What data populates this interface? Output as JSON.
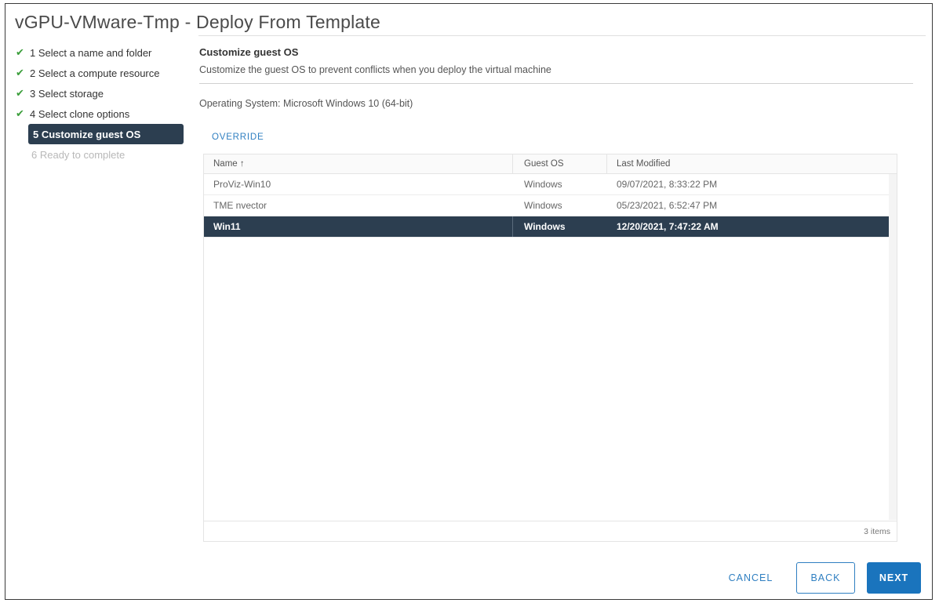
{
  "window": {
    "title": "vGPU-VMware-Tmp - Deploy From Template"
  },
  "steps": [
    {
      "label": "1 Select a name and folder",
      "state": "done"
    },
    {
      "label": "2 Select a compute resource",
      "state": "done"
    },
    {
      "label": "3 Select storage",
      "state": "done"
    },
    {
      "label": "4 Select clone options",
      "state": "done"
    },
    {
      "label": "5 Customize guest OS",
      "state": "active"
    },
    {
      "label": "6 Ready to complete",
      "state": "disabled"
    }
  ],
  "main": {
    "title": "Customize guest OS",
    "description": "Customize the guest OS to prevent conflicts when you deploy the virtual machine",
    "os_line": "Operating System: Microsoft Windows 10 (64-bit)",
    "override_label": "OVERRIDE"
  },
  "grid": {
    "columns": {
      "name": "Name ↑",
      "guest": "Guest OS",
      "modified": "Last Modified"
    },
    "rows": [
      {
        "name": "ProViz-Win10",
        "guest": "Windows",
        "modified": "09/07/2021, 8:33:22 PM",
        "selected": false
      },
      {
        "name": "TME nvector",
        "guest": "Windows",
        "modified": "05/23/2021, 6:52:47 PM",
        "selected": false
      },
      {
        "name": "Win11",
        "guest": "Windows",
        "modified": "12/20/2021, 7:47:22 AM",
        "selected": true
      }
    ],
    "footer": "3 items"
  },
  "buttons": {
    "cancel": "CANCEL",
    "back": "BACK",
    "next": "NEXT"
  },
  "colors": {
    "accent": "#1a74bd",
    "selected_bg": "#2c3e50",
    "check": "#3b9e3b",
    "link": "#2f7fc1"
  }
}
